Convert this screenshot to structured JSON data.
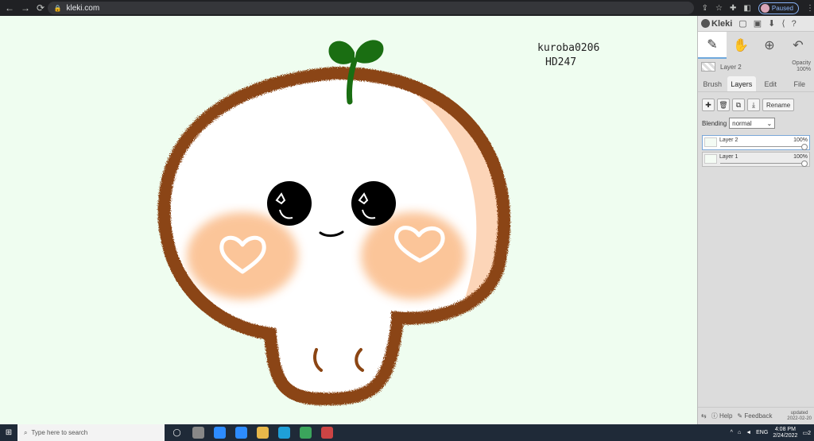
{
  "browser": {
    "url": "kleki.com",
    "profile_status": "Paused",
    "nav_icons": [
      "back-icon",
      "forward-icon",
      "reload-icon"
    ]
  },
  "canvas": {
    "background": "#effdf0",
    "watermark_line1": "kuroba0206",
    "watermark_line2": "HD247"
  },
  "panel": {
    "app_name": "Kleki",
    "current_layer": "Layer 2",
    "opacity_label": "Opacity",
    "opacity_value": "100%",
    "tabs": [
      "Brush",
      "Layers",
      "Edit",
      "File"
    ],
    "active_tab": "Layers",
    "rename_label": "Rename",
    "blending_label": "Blending",
    "blending_value": "normal",
    "layers": [
      {
        "name": "Layer 2",
        "opacity": "100%"
      },
      {
        "name": "Layer 1",
        "opacity": "100%"
      }
    ],
    "help_label": "Help",
    "feedback_label": "Feedback",
    "updated_label": "updated",
    "updated_date": "2022-02-20"
  },
  "taskbar": {
    "search_placeholder": "Type here to search",
    "language": "ENG",
    "time": "4:08 PM",
    "date": "2/24/2022",
    "notification_count": "2"
  },
  "colors": {
    "outline": "#8b4513",
    "sprout": "#1a6e12",
    "blush": "#fbbf8f",
    "shade": "#fcd5b8",
    "eyes": "#000000"
  }
}
